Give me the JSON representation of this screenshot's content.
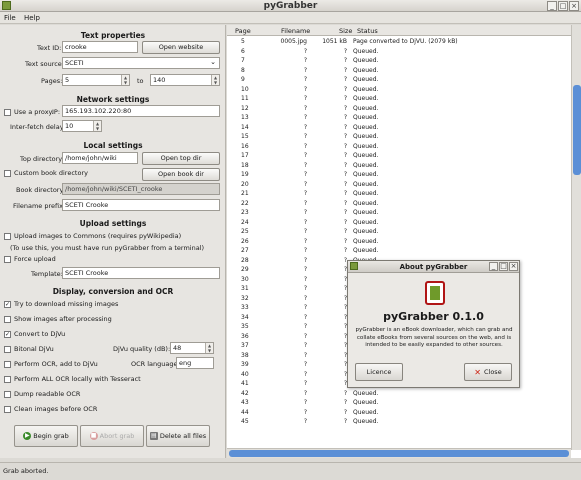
{
  "window": {
    "title": "pyGrabber",
    "minimize": "_",
    "maximize": "□",
    "close": "×"
  },
  "menu": {
    "file": "File",
    "help": "Help"
  },
  "text_properties": {
    "heading": "Text properties",
    "text_id_label": "Text ID:",
    "text_id_value": "crooke",
    "open_website": "Open website",
    "text_source_label": "Text source:",
    "text_source_value": "SCETI",
    "pages_label": "Pages:",
    "pages_from": "5",
    "pages_to_label": "to",
    "pages_to": "140"
  },
  "network": {
    "heading": "Network settings",
    "use_proxy_label": "Use a proxy.",
    "ip_label": "IP:",
    "ip_value": "165.193.102.220:80",
    "delay_label": "Inter-fetch delay:",
    "delay_value": "10"
  },
  "local": {
    "heading": "Local settings",
    "top_dir_label": "Top directory:",
    "top_dir_value": "/home/john/wiki",
    "open_top_dir": "Open top dir",
    "custom_book_dir_label": "Custom book directory",
    "open_book_dir": "Open book dir",
    "book_dir_label": "Book directory:",
    "book_dir_value": "/home/john/wiki/SCETI_crooke",
    "prefix_label": "Filename prefix:",
    "prefix_value": "SCETI Crooke"
  },
  "upload": {
    "heading": "Upload settings",
    "upload_label": "Upload images to Commons (requires pyWikipedia)",
    "note": "(To use this, you must have run pyGrabber from a terminal)",
    "force_upload_label": "Force upload",
    "template_label": "Template:",
    "template_value": "SCETI Crooke"
  },
  "display": {
    "heading": "Display, conversion and OCR",
    "try_download": "Try to download missing images",
    "show_images": "Show images after processing",
    "convert_djvu": "Convert to DjVu",
    "bitonal": "Bitonal DjVu",
    "djvu_quality_label": "DjVu quality (dB):",
    "djvu_quality_value": "48",
    "perform_ocr": "Perform OCR, add to DjVu",
    "ocr_language_label": "OCR language:",
    "ocr_language_value": "eng",
    "ocr_locally": "Perform ALL OCR locally with Tesseract",
    "dump_readable": "Dump readable OCR",
    "clean_images": "Clean images before OCR"
  },
  "actions": {
    "begin": "Begin grab",
    "abort": "Abort grab",
    "delete": "Delete all files"
  },
  "table": {
    "headers": {
      "page": "Page",
      "filename": "Filename",
      "size": "Size",
      "status": "Status"
    },
    "rows": [
      {
        "page": "5",
        "filename": "0005.jpg",
        "size": "1051 kB",
        "status": "Page converted to DjVU. (2079 kB)"
      },
      {
        "page": "6",
        "filename": "?",
        "size": "?",
        "status": "Queued."
      },
      {
        "page": "7",
        "filename": "?",
        "size": "?",
        "status": "Queued."
      },
      {
        "page": "8",
        "filename": "?",
        "size": "?",
        "status": "Queued."
      },
      {
        "page": "9",
        "filename": "?",
        "size": "?",
        "status": "Queued."
      },
      {
        "page": "10",
        "filename": "?",
        "size": "?",
        "status": "Queued."
      },
      {
        "page": "11",
        "filename": "?",
        "size": "?",
        "status": "Queued."
      },
      {
        "page": "12",
        "filename": "?",
        "size": "?",
        "status": "Queued."
      },
      {
        "page": "13",
        "filename": "?",
        "size": "?",
        "status": "Queued."
      },
      {
        "page": "14",
        "filename": "?",
        "size": "?",
        "status": "Queued."
      },
      {
        "page": "15",
        "filename": "?",
        "size": "?",
        "status": "Queued."
      },
      {
        "page": "16",
        "filename": "?",
        "size": "?",
        "status": "Queued."
      },
      {
        "page": "17",
        "filename": "?",
        "size": "?",
        "status": "Queued."
      },
      {
        "page": "18",
        "filename": "?",
        "size": "?",
        "status": "Queued."
      },
      {
        "page": "19",
        "filename": "?",
        "size": "?",
        "status": "Queued."
      },
      {
        "page": "20",
        "filename": "?",
        "size": "?",
        "status": "Queued."
      },
      {
        "page": "21",
        "filename": "?",
        "size": "?",
        "status": "Queued."
      },
      {
        "page": "22",
        "filename": "?",
        "size": "?",
        "status": "Queued."
      },
      {
        "page": "23",
        "filename": "?",
        "size": "?",
        "status": "Queued."
      },
      {
        "page": "24",
        "filename": "?",
        "size": "?",
        "status": "Queued."
      },
      {
        "page": "25",
        "filename": "?",
        "size": "?",
        "status": "Queued."
      },
      {
        "page": "26",
        "filename": "?",
        "size": "?",
        "status": "Queued."
      },
      {
        "page": "27",
        "filename": "?",
        "size": "?",
        "status": "Queued."
      },
      {
        "page": "28",
        "filename": "?",
        "size": "?",
        "status": "Queued."
      },
      {
        "page": "29",
        "filename": "?",
        "size": "?",
        "status": "Queued."
      },
      {
        "page": "30",
        "filename": "?",
        "size": "?",
        "status": "Queued."
      },
      {
        "page": "31",
        "filename": "?",
        "size": "?",
        "status": "Queued."
      },
      {
        "page": "32",
        "filename": "?",
        "size": "?",
        "status": "Queued."
      },
      {
        "page": "33",
        "filename": "?",
        "size": "?",
        "status": "Queued."
      },
      {
        "page": "34",
        "filename": "?",
        "size": "?",
        "status": "Queued."
      },
      {
        "page": "35",
        "filename": "?",
        "size": "?",
        "status": "Queued."
      },
      {
        "page": "36",
        "filename": "?",
        "size": "?",
        "status": "Queued."
      },
      {
        "page": "37",
        "filename": "?",
        "size": "?",
        "status": "Queued."
      },
      {
        "page": "38",
        "filename": "?",
        "size": "?",
        "status": "Queued."
      },
      {
        "page": "39",
        "filename": "?",
        "size": "?",
        "status": "Queued."
      },
      {
        "page": "40",
        "filename": "?",
        "size": "?",
        "status": "Queued."
      },
      {
        "page": "41",
        "filename": "?",
        "size": "?",
        "status": "Queued."
      },
      {
        "page": "42",
        "filename": "?",
        "size": "?",
        "status": "Queued."
      },
      {
        "page": "43",
        "filename": "?",
        "size": "?",
        "status": "Queued."
      },
      {
        "page": "44",
        "filename": "?",
        "size": "?",
        "status": "Queued."
      },
      {
        "page": "45",
        "filename": "?",
        "size": "?",
        "status": "Queued."
      }
    ]
  },
  "status_bar": {
    "text": "Grab aborted."
  },
  "about": {
    "title": "About pyGrabber",
    "name": "pyGrabber 0.1.0",
    "description": "pyGrabber is an eBook downloader, which can grab and collate eBooks from several sources on the web, and is intended to be easily expanded to other sources.",
    "licence": "Licence",
    "close": "Close"
  },
  "colors": {
    "accent": "#5b8fd6",
    "logo_red": "#b01515",
    "logo_green": "#6f9a2a"
  }
}
